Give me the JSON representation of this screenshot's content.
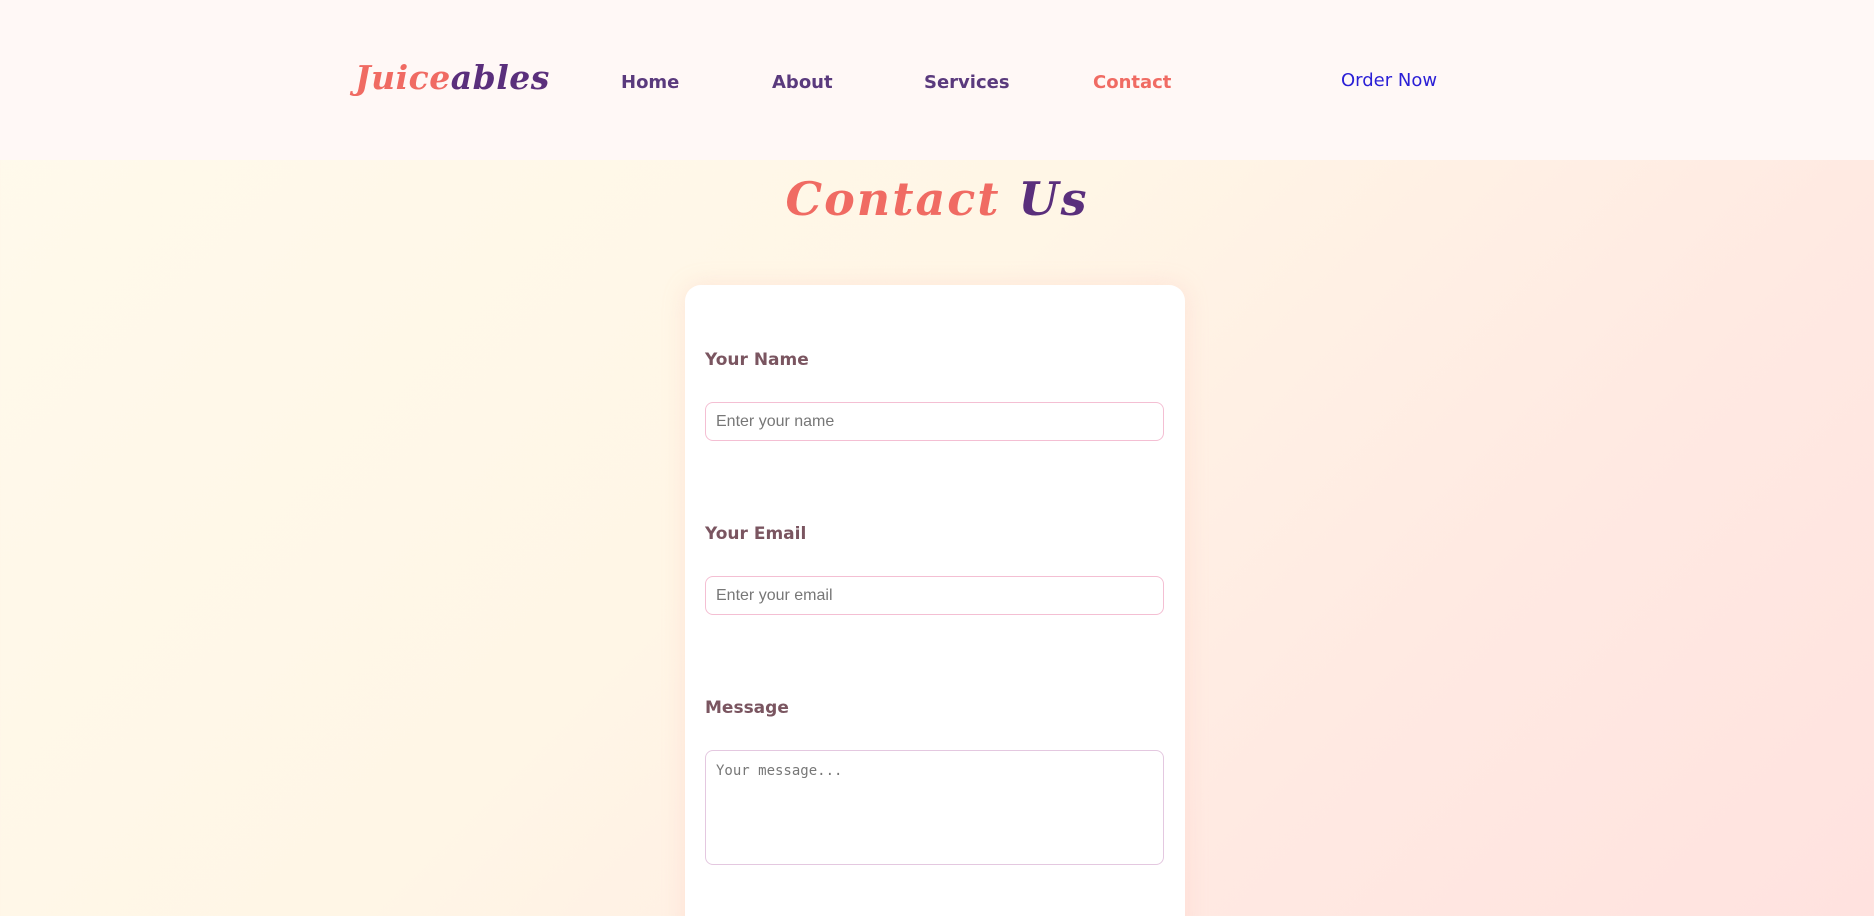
{
  "header": {
    "logo": {
      "part1": "Juice",
      "part2": "ables"
    },
    "nav": [
      {
        "label": "Home",
        "active": false
      },
      {
        "label": "About",
        "active": false
      },
      {
        "label": "Services",
        "active": false
      },
      {
        "label": "Contact",
        "active": true
      }
    ],
    "cta_label": "Order Now"
  },
  "page": {
    "title_part1": "Contact",
    "title_part2": "Us"
  },
  "form": {
    "name": {
      "label": "Your Name",
      "value": "",
      "placeholder": "Enter your name"
    },
    "email": {
      "label": "Your Email",
      "value": "",
      "placeholder": "Enter your email"
    },
    "message": {
      "label": "Message",
      "value": "",
      "placeholder": "Your message..."
    }
  },
  "colors": {
    "accent": "#f06b63",
    "brand_purple": "#5a2f7c",
    "cta_link": "#2a1fd6",
    "label_text": "#7a5560",
    "input_border": "#f4bfd3"
  }
}
